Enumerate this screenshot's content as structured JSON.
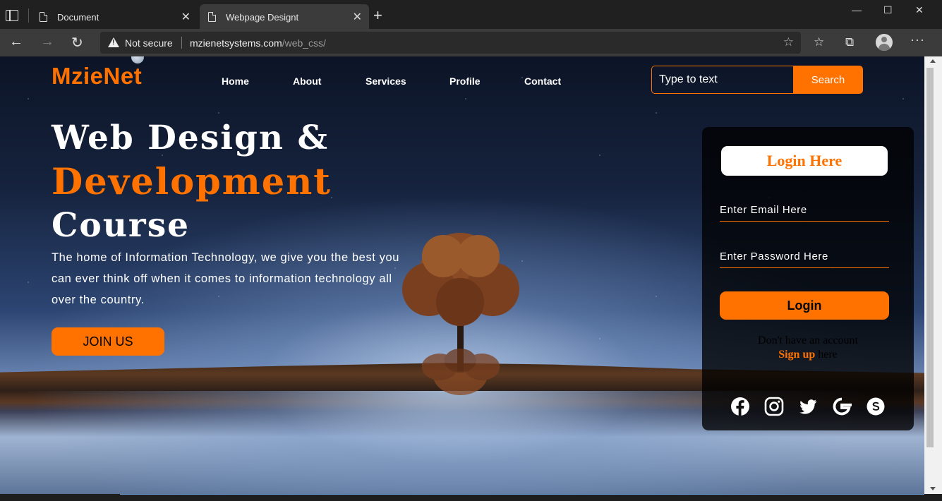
{
  "browser": {
    "tabs": [
      {
        "title": "Document",
        "active": false
      },
      {
        "title": "Webpage Designt",
        "active": true
      }
    ],
    "address": {
      "security_label": "Not secure",
      "url_host": "mzienetsystems.com",
      "url_path": "/web_css/"
    }
  },
  "site": {
    "logo": "MzieNet",
    "nav": [
      "Home",
      "About",
      "Services",
      "Profile",
      "Contact"
    ],
    "search": {
      "placeholder": "Type to text",
      "button": "Search"
    }
  },
  "hero": {
    "line1": "Web Design &",
    "line2": "Development",
    "line3": "Course",
    "paragraph": "The home of Information Technology, we give you the best you can ever think off when it comes to information technology all over the country.",
    "cta": "JOIN US"
  },
  "login": {
    "title": "Login Here",
    "email_placeholder": "Enter Email Here",
    "password_placeholder": "Enter Password Here",
    "button": "Login",
    "signup_prompt": "Don't have an account",
    "signup_link": "Sign up",
    "signup_suffix": " here",
    "social": [
      "facebook-icon",
      "instagram-icon",
      "twitter-icon",
      "google-icon",
      "skype-icon"
    ]
  },
  "colors": {
    "accent": "#ff7200"
  }
}
